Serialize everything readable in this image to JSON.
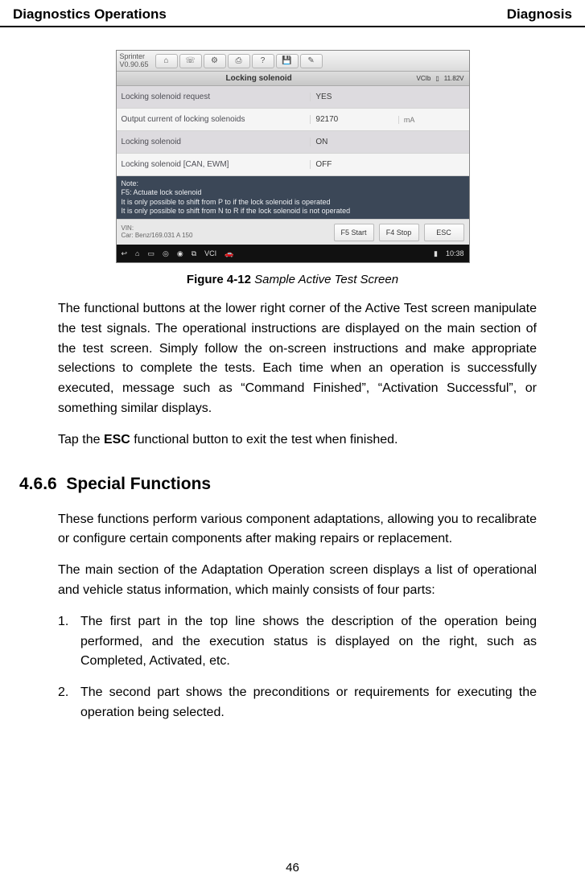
{
  "header": {
    "left": "Diagnostics Operations",
    "right": "Diagnosis"
  },
  "device": {
    "brand_line1": "Sprinter",
    "brand_line2": "V0.90.65",
    "subbar_title": "Locking solenoid",
    "vci_label": "VCIb",
    "voltage": "11.82V",
    "rows": [
      {
        "label": "Locking solenoid request",
        "value": "YES",
        "unit": ""
      },
      {
        "label": "Output current of locking solenoids",
        "value": "92170",
        "unit": "mA"
      },
      {
        "label": "Locking solenoid",
        "value": "ON",
        "unit": ""
      },
      {
        "label": "Locking solenoid [CAN, EWM]",
        "value": "OFF",
        "unit": ""
      }
    ],
    "note_title": "Note:",
    "note_l1": "F5: Actuate lock solenoid",
    "note_l2": "It is only possible to shift from P to if the lock solenoid is operated",
    "note_l3": "It is only possible to shift from N to R if the lock solenoid is not operated",
    "vin_label": "VIN:",
    "vin_value": "Car: Benz/169.031 A 150",
    "btn_f5": "F5 Start",
    "btn_f4": "F4 Stop",
    "btn_esc": "ESC",
    "clock": "10:38"
  },
  "caption_bold": "Figure 4-12",
  "caption_italic": " Sample Active Test Screen",
  "p1": "The functional buttons at the lower right corner of the Active Test screen manipulate the test signals. The operational instructions are displayed on the main section of the test screen. Simply follow the on-screen instructions and make appropriate selections to complete the tests. Each time when an operation is successfully executed, message such as “Command Finished”, “Activation Successful”, or something similar displays.",
  "p2a": "Tap the ",
  "p2b": "ESC",
  "p2c": " functional button to exit the test when finished.",
  "section_number": "4.6.6",
  "section_title": "Special Functions",
  "p3": "These functions perform various component adaptations, allowing you to recalibrate or configure certain components after making repairs or replacement.",
  "p4": "The main section of the Adaptation Operation screen displays a list of operational and vehicle status information, which mainly consists of four parts:",
  "li1_num": "1.",
  "li1": "The first part in the top line shows the description of the operation being performed, and the execution status is displayed on the right, such as Completed, Activated, etc.",
  "li2_num": "2.",
  "li2": "The second part shows the preconditions or requirements for executing the operation being selected.",
  "page_number": "46"
}
